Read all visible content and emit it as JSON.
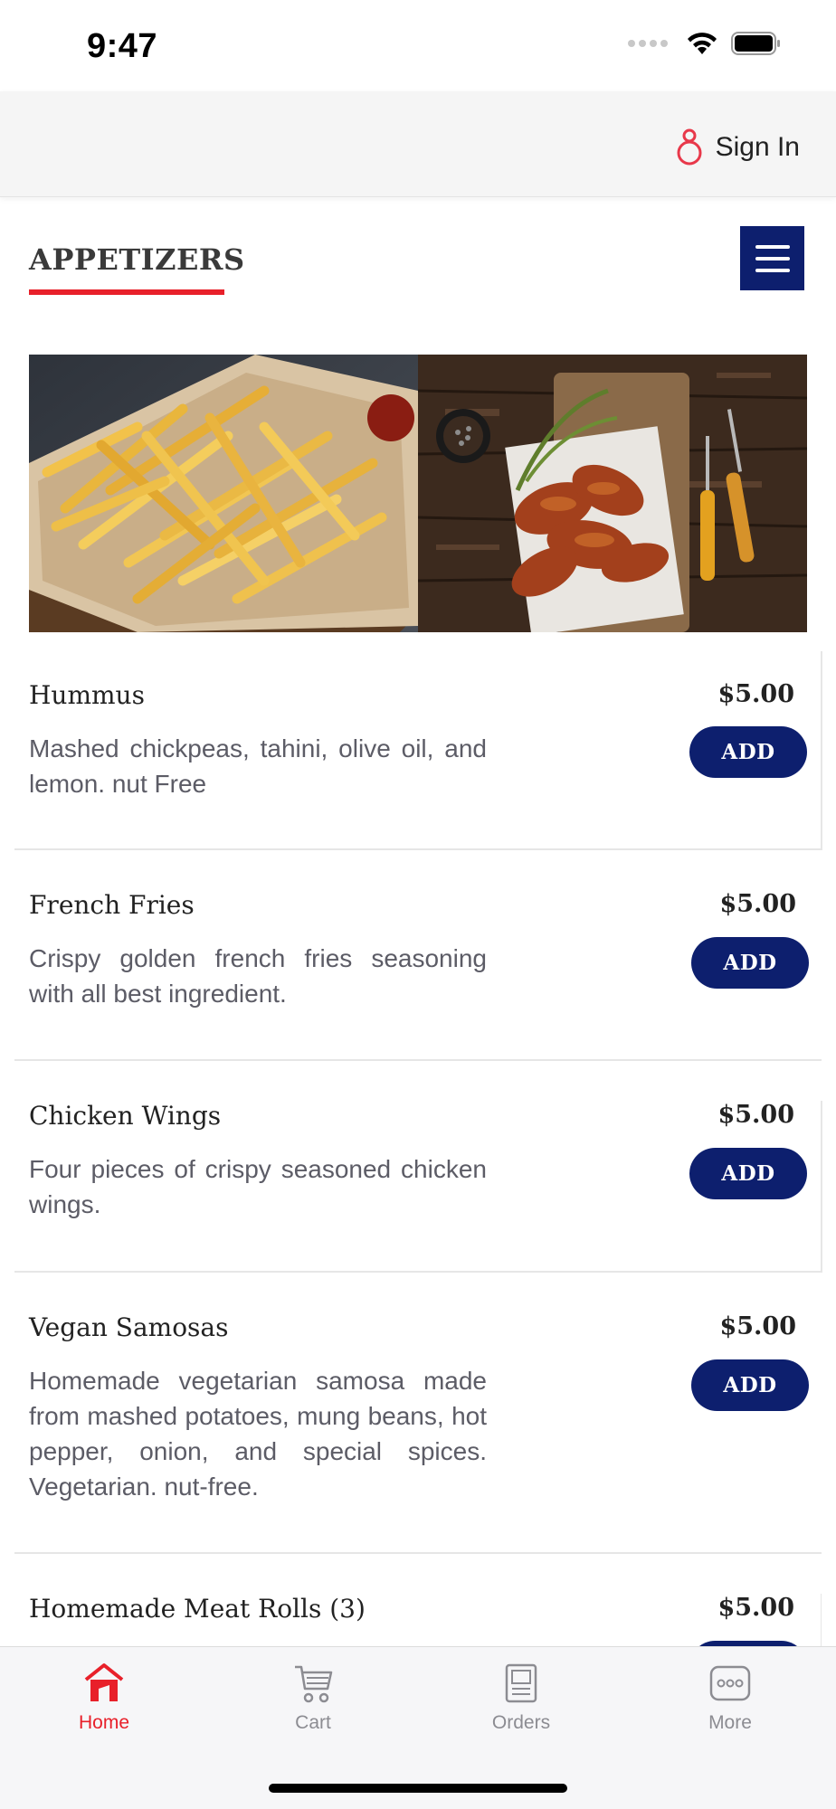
{
  "status_bar": {
    "time": "9:47"
  },
  "header": {
    "sign_in_label": "Sign In"
  },
  "section": {
    "title": "APPETIZERS"
  },
  "menu_items": [
    {
      "name": "Hummus",
      "description": "Mashed chickpeas, tahini, olive oil, and lemon. nut Free",
      "price": "$5.00",
      "add_label": "ADD"
    },
    {
      "name": "French Fries",
      "description": "Crispy golden french fries seasoning with all best ingredient.",
      "price": "$5.00",
      "add_label": "ADD"
    },
    {
      "name": "Chicken Wings",
      "description": "Four pieces of crispy seasoned chicken wings.",
      "price": "$5.00",
      "add_label": "ADD"
    },
    {
      "name": "Vegan Samosas",
      "description": "Homemade vegetarian samosa made from mashed potatoes, mung beans, hot pepper, onion, and special spices. Vegetarian. nut-free.",
      "price": "$5.00",
      "add_label": "ADD"
    },
    {
      "name": "Homemade Meat Rolls (3)",
      "price": "$5.00"
    }
  ],
  "bottom_nav": [
    {
      "label": "Home",
      "icon": "home-icon",
      "active": true
    },
    {
      "label": "Cart",
      "icon": "cart-icon",
      "active": false
    },
    {
      "label": "Orders",
      "icon": "orders-icon",
      "active": false
    },
    {
      "label": "More",
      "icon": "more-icon",
      "active": false
    }
  ],
  "colors": {
    "brand_navy": "#0d1f6e",
    "accent_red": "#e8202a",
    "muted_text": "#5c5c66"
  }
}
